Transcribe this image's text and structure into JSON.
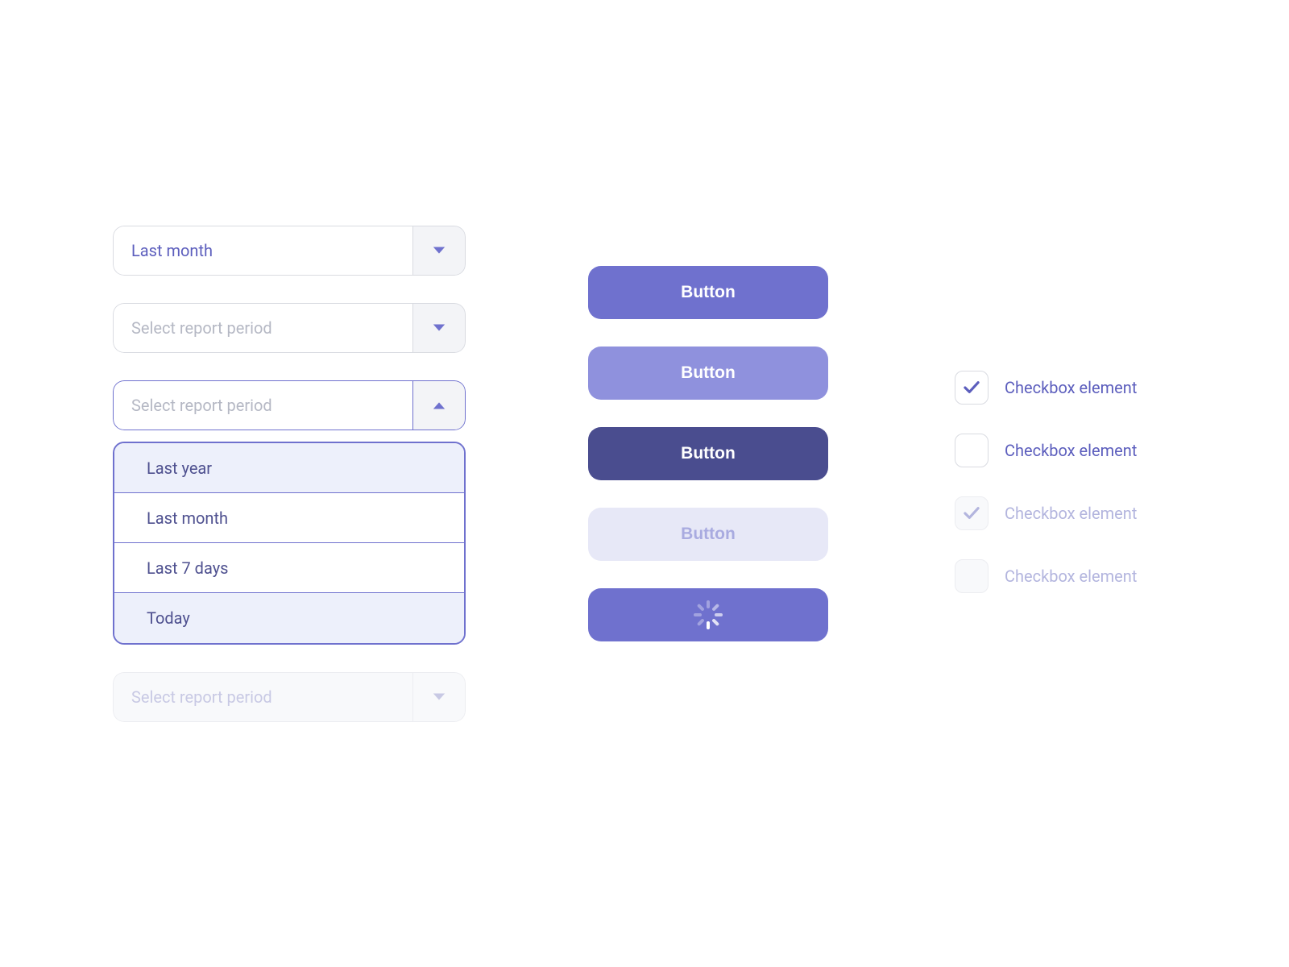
{
  "dropdowns": {
    "selected": {
      "value": "Last month"
    },
    "placeholder": "Select report period",
    "open": {
      "options": [
        "Last year",
        "Last month",
        "Last 7 days",
        "Today"
      ],
      "highlighted_indices": [
        0,
        3
      ]
    }
  },
  "buttons": {
    "primary": "Button",
    "hover": "Button",
    "pressed": "Button",
    "disabled": "Button"
  },
  "checkboxes": {
    "label": "Checkbox element",
    "items": [
      {
        "checked": true,
        "disabled": false
      },
      {
        "checked": false,
        "disabled": false
      },
      {
        "checked": true,
        "disabled": true
      },
      {
        "checked": false,
        "disabled": true
      }
    ]
  },
  "colors": {
    "accent": "#6F71CE",
    "accent_dark": "#4A4D8F",
    "accent_light": "#8F91DD",
    "accent_pale": "#E7E8F7",
    "text_accent": "#5C5EBD",
    "placeholder": "#B5B8C4",
    "border": "#D9DBE1"
  }
}
